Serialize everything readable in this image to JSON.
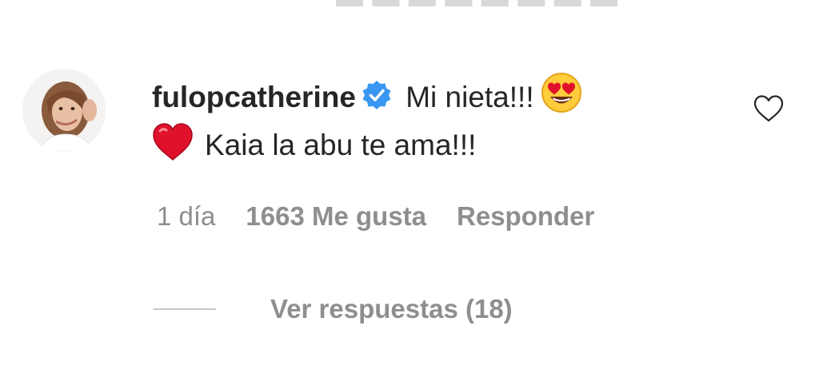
{
  "comment": {
    "username": "fulopcatherine",
    "verified_icon": "verified-badge-icon",
    "text_part1": "Mi nieta!!!",
    "text_part2": "Kaia la abu te ama!!!",
    "emoji_1": "heart-eyes-emoji",
    "emoji_2": "red-heart-emoji",
    "time": "1 día",
    "likes": "1663 Me gusta",
    "reply_label": "Responder",
    "view_replies": "Ver respuestas (18)"
  },
  "colors": {
    "primary_text": "#262626",
    "secondary_text": "#8e8e8e",
    "verified_blue": "#3897f0",
    "heart_red": "#e0112b"
  }
}
